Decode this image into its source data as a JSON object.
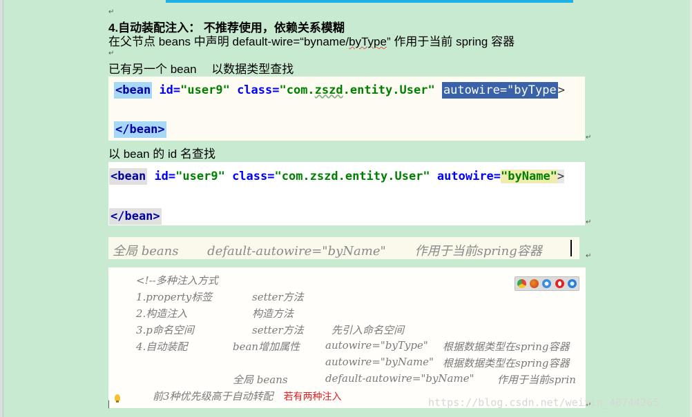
{
  "heading": "4.自动装配注入： 不推荐使用，依赖关系模糊",
  "para1": {
    "pre": "在父节点 beans 中声明 default-wire=“byname/",
    "squiggle": "byType",
    "post": "” 作用于当前 spring 容器"
  },
  "para2": "已有另一个 bean　 以数据类型查找",
  "code1": {
    "open_tag": "<bean",
    "id_attr": "id=",
    "id_val": "\"user9\"",
    "class_attr": "class=",
    "class_val_a": "\"com.",
    "class_val_b": "zszd",
    "class_val_c": ".entity.User\"",
    "autowire_sel": "autowire=\"byType",
    "close_gt": ">",
    "end_tag": "</bean>"
  },
  "para3": "以 bean 的 id 名查找",
  "code2": {
    "open_tag": "<bean",
    "id_attr": "id=",
    "id_val": "\"user9\"",
    "class_attr": "class=",
    "class_val": "\"com.zszd.entity.User\"",
    "autowire_attr": "autowire=",
    "autowire_val": "\"byName\"",
    "close_gt": ">",
    "end_tag": "</bean>"
  },
  "global_line": "全局 beans　　 default-autowire=\"byName\"　　 作用于当前spring容器",
  "comment_block": {
    "line0": "<!--多种注入方式",
    "row1_a": "1.property标签",
    "row1_b": "setter方法",
    "row2_a": "2.构造注入",
    "row2_b": "构造方法",
    "row3_a": "3.p命名空间",
    "row3_b": "setter方法",
    "row3_c": "先引入命名空间",
    "row4_a": "4.自动装配",
    "row4_b": "bean增加属性",
    "row4_c": "autowire=\"byType\"",
    "row4_d": "根据数据类型在spring容器",
    "row5_c": "autowire=\"byName\"",
    "row5_d": "根据数据类型在spring容器",
    "row6_b": "全局 beans",
    "row6_c": "default-autowire=\"byName\"",
    "row6_d": "作用于当前sprin",
    "row7_a": "前3种优先级高于自动转配",
    "row7_red": "若有两种注入"
  },
  "watermark": "https://blog.csdn.net/weixin_40744265",
  "browser_icon_colors": [
    "#e94235",
    "#f08a24",
    "#3a8de0",
    "#e02424",
    "#2a7fd4"
  ]
}
